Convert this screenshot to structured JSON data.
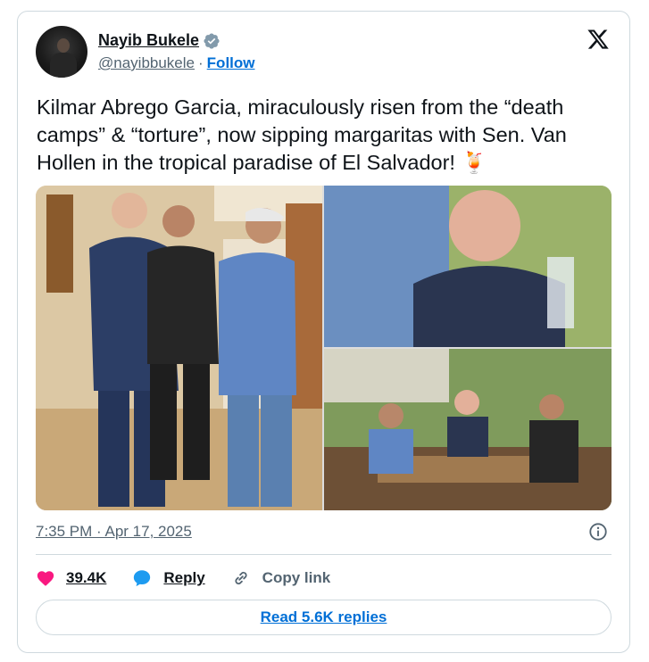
{
  "author": {
    "name": "Nayib Bukele",
    "handle": "@nayibbukele",
    "follow_label": "Follow",
    "separator": "·"
  },
  "tweet": {
    "text": "Kilmar Abrego Garcia, miraculously risen from the “death camps” & “torture”, now sipping margaritas with Sen. Van Hollen in the tropical paradise of El Salvador! 🍹",
    "timestamp": "7:35 PM · Apr 17, 2025"
  },
  "media": {
    "count": 3
  },
  "actions": {
    "likes": "39.4K",
    "reply_label": "Reply",
    "copy_link_label": "Copy link"
  },
  "footer": {
    "read_replies_label": "Read 5.6K replies"
  },
  "colors": {
    "like": "#f91880",
    "reply": "#1d9bf0",
    "verified": "#829aab",
    "link": "#006fd6"
  },
  "icons": [
    "verified-icon",
    "x-logo-icon",
    "info-icon",
    "heart-icon",
    "reply-icon",
    "link-icon"
  ]
}
